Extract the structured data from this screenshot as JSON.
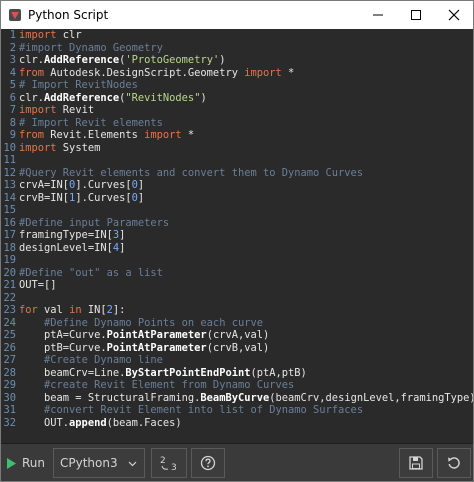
{
  "window": {
    "title": "Python Script",
    "minimize_label": "—",
    "maximize_label": "☐",
    "close_label": "✕"
  },
  "editor": {
    "lines": [
      {
        "n": "1",
        "tokens": [
          [
            "kw",
            "import"
          ],
          [
            "tx",
            " clr"
          ]
        ]
      },
      {
        "n": "2",
        "tokens": [
          [
            "cm",
            "#import Dynamo Geometry"
          ]
        ]
      },
      {
        "n": "3",
        "tokens": [
          [
            "tx",
            "clr."
          ],
          [
            "fn",
            "AddReference"
          ],
          [
            "tx",
            "("
          ],
          [
            "st",
            "'ProtoGeometry'"
          ],
          [
            "tx",
            ")"
          ]
        ]
      },
      {
        "n": "4",
        "tokens": [
          [
            "kw",
            "from"
          ],
          [
            "tx",
            " Autodesk.DesignScript.Geometry "
          ],
          [
            "kw",
            "import"
          ],
          [
            "tx",
            " *"
          ]
        ]
      },
      {
        "n": "5",
        "tokens": [
          [
            "cm",
            "# Import RevitNodes"
          ]
        ]
      },
      {
        "n": "6",
        "tokens": [
          [
            "tx",
            "clr."
          ],
          [
            "fn",
            "AddReference"
          ],
          [
            "tx",
            "("
          ],
          [
            "st",
            "\"RevitNodes\""
          ],
          [
            "tx",
            ")"
          ]
        ]
      },
      {
        "n": "7",
        "tokens": [
          [
            "kw",
            "import"
          ],
          [
            "tx",
            " Revit"
          ]
        ]
      },
      {
        "n": "8",
        "tokens": [
          [
            "cm",
            "# Import Revit elements"
          ]
        ]
      },
      {
        "n": "9",
        "tokens": [
          [
            "kw",
            "from"
          ],
          [
            "tx",
            " Revit.Elements "
          ],
          [
            "kw",
            "import"
          ],
          [
            "tx",
            " *"
          ]
        ]
      },
      {
        "n": "10",
        "tokens": [
          [
            "kw",
            "import"
          ],
          [
            "tx",
            " System"
          ]
        ]
      },
      {
        "n": "11",
        "tokens": []
      },
      {
        "n": "12",
        "tokens": [
          [
            "cm",
            "#Query Revit elements and convert them to Dynamo Curves"
          ]
        ]
      },
      {
        "n": "13",
        "tokens": [
          [
            "tx",
            "crvA=IN["
          ],
          [
            "br",
            "0"
          ],
          [
            "tx",
            "].Curves["
          ],
          [
            "br",
            "0"
          ],
          [
            "tx",
            "]"
          ]
        ]
      },
      {
        "n": "14",
        "tokens": [
          [
            "tx",
            "crvB=IN["
          ],
          [
            "br",
            "1"
          ],
          [
            "tx",
            "].Curves["
          ],
          [
            "br",
            "0"
          ],
          [
            "tx",
            "]"
          ]
        ]
      },
      {
        "n": "15",
        "tokens": []
      },
      {
        "n": "16",
        "tokens": [
          [
            "cm",
            "#Define input Parameters"
          ]
        ]
      },
      {
        "n": "17",
        "tokens": [
          [
            "tx",
            "framingType=IN["
          ],
          [
            "br",
            "3"
          ],
          [
            "tx",
            "]"
          ]
        ]
      },
      {
        "n": "18",
        "tokens": [
          [
            "tx",
            "designLevel=IN["
          ],
          [
            "br",
            "4"
          ],
          [
            "tx",
            "]"
          ]
        ]
      },
      {
        "n": "19",
        "tokens": []
      },
      {
        "n": "20",
        "tokens": [
          [
            "cm",
            "#Define \"out\" as a list"
          ]
        ]
      },
      {
        "n": "21",
        "tokens": [
          [
            "tx",
            "OUT=[]"
          ]
        ]
      },
      {
        "n": "22",
        "tokens": []
      },
      {
        "n": "23",
        "tokens": [
          [
            "kw",
            "for"
          ],
          [
            "tx",
            " val "
          ],
          [
            "kw",
            "in"
          ],
          [
            "tx",
            " IN["
          ],
          [
            "br",
            "2"
          ],
          [
            "tx",
            "]:"
          ]
        ]
      },
      {
        "n": "24",
        "tokens": [
          [
            "tx",
            "    "
          ],
          [
            "cm",
            "#Define Dynamo Points on each curve"
          ]
        ]
      },
      {
        "n": "25",
        "tokens": [
          [
            "tx",
            "    ptA=Curve."
          ],
          [
            "fn",
            "PointAtParameter"
          ],
          [
            "tx",
            "(crvA,val)"
          ]
        ]
      },
      {
        "n": "26",
        "tokens": [
          [
            "tx",
            "    ptB=Curve."
          ],
          [
            "fn",
            "PointAtParameter"
          ],
          [
            "tx",
            "(crvB,val)"
          ]
        ]
      },
      {
        "n": "27",
        "tokens": [
          [
            "tx",
            "    "
          ],
          [
            "cm",
            "#Create Dynamo line"
          ]
        ]
      },
      {
        "n": "28",
        "tokens": [
          [
            "tx",
            "    beamCrv=Line."
          ],
          [
            "fn",
            "ByStartPointEndPoint"
          ],
          [
            "tx",
            "(ptA,ptB)"
          ]
        ]
      },
      {
        "n": "29",
        "tokens": [
          [
            "tx",
            "    "
          ],
          [
            "cm",
            "#create Revit Element from Dynamo Curves"
          ]
        ]
      },
      {
        "n": "30",
        "tokens": [
          [
            "tx",
            "    beam = StructuralFraming."
          ],
          [
            "fn",
            "BeamByCurve"
          ],
          [
            "tx",
            "(beamCrv,designLevel,framingType)"
          ]
        ]
      },
      {
        "n": "31",
        "tokens": [
          [
            "tx",
            "    "
          ],
          [
            "cm",
            "#convert Revit Element into list of Dynamo Surfaces"
          ]
        ]
      },
      {
        "n": "32",
        "tokens": [
          [
            "tx",
            "    OUT."
          ],
          [
            "fn",
            "append"
          ],
          [
            "tx",
            "(beam.Faces)"
          ]
        ]
      }
    ]
  },
  "toolbar": {
    "run_label": "Run",
    "engine_value": "CPython3",
    "migration_icon_label": "2 3",
    "help_icon": "question-circle-icon",
    "save_icon": "floppy-disk-icon",
    "revert_icon": "undo-icon"
  },
  "colors": {
    "background": "#2a2a2a",
    "keyword": "#e8734a",
    "comment": "#6a7f99",
    "string": "#b9d88a",
    "run_accent": "#3fbf6f"
  }
}
